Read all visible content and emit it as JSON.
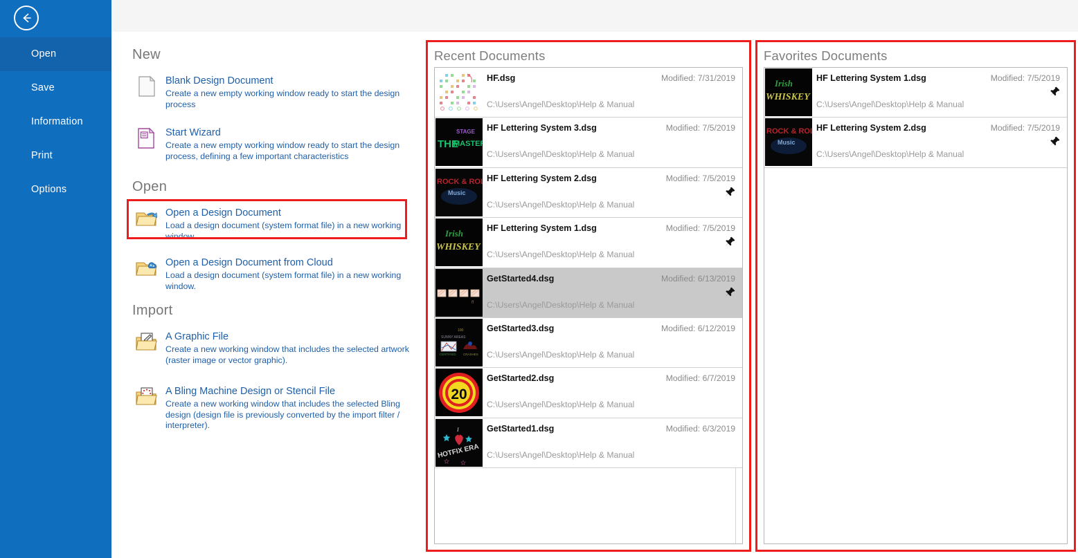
{
  "sidebar": {
    "back_icon": "back-arrow-icon",
    "items": [
      {
        "label": "Open",
        "active": true
      },
      {
        "label": "Save",
        "active": false
      },
      {
        "label": "Information",
        "active": false
      },
      {
        "label": "Print",
        "active": false
      },
      {
        "label": "Options",
        "active": false
      }
    ]
  },
  "sections": {
    "new": {
      "title": "New",
      "commands": [
        {
          "icon": "blank-document-icon",
          "title": "Blank Design Document",
          "description": "Create a new empty working window ready to start the design process"
        },
        {
          "icon": "wizard-document-icon",
          "title": "Start Wizard",
          "description": "Create a new empty working window ready to start the design process, defining a few important characteristics"
        }
      ]
    },
    "open": {
      "title": "Open",
      "commands": [
        {
          "icon": "open-folder-icon",
          "title": "Open a Design Document",
          "description": "Load a design document (system format file) in a new working window.",
          "highlighted": true
        },
        {
          "icon": "cloud-folder-icon",
          "title": "Open a Design Document from Cloud",
          "description": "Load a design document (system format file) in a new working window.",
          "highlighted": false
        }
      ]
    },
    "import": {
      "title": "Import",
      "commands": [
        {
          "icon": "graphic-file-folder-icon",
          "title": "A Graphic File",
          "description": "Create a new working window that includes the selected artwork (raster image or vector graphic)."
        },
        {
          "icon": "bling-file-folder-icon",
          "title": "A Bling Machine Design or Stencil File",
          "description": "Create a new working window that includes the selected Bling design (design file is previously converted by the import filter / interpreter)."
        }
      ]
    }
  },
  "recent_documents": {
    "title": "Recent Documents",
    "items": [
      {
        "name": "HF.dsg",
        "modified": "Modified: 7/31/2019",
        "path": "C:\\Users\\Angel\\Desktop\\Help & Manual",
        "pinned": false,
        "selected": false,
        "thumb": "hf-grid"
      },
      {
        "name": "HF Lettering System 3.dsg",
        "modified": "Modified: 7/5/2019",
        "path": "C:\\Users\\Angel\\Desktop\\Help & Manual",
        "pinned": false,
        "selected": false,
        "thumb": "the-stage-master"
      },
      {
        "name": "HF Lettering System 2.dsg",
        "modified": "Modified: 7/5/2019",
        "path": "C:\\Users\\Angel\\Desktop\\Help & Manual",
        "pinned": true,
        "selected": false,
        "thumb": "rock-n-roll"
      },
      {
        "name": "HF Lettering System 1.dsg",
        "modified": "Modified: 7/5/2019",
        "path": "C:\\Users\\Angel\\Desktop\\Help & Manual",
        "pinned": true,
        "selected": false,
        "thumb": "irish-whiskey"
      },
      {
        "name": "GetStarted4.dsg",
        "modified": "Modified: 6/13/2019",
        "path": "C:\\Users\\Angel\\Desktop\\Help & Manual",
        "pinned": true,
        "selected": true,
        "thumb": "four-squares"
      },
      {
        "name": "GetStarted3.dsg",
        "modified": "Modified: 6/12/2019",
        "path": "C:\\Users\\Angel\\Desktop\\Help & Manual",
        "pinned": false,
        "selected": false,
        "thumb": "scene"
      },
      {
        "name": "GetStarted2.dsg",
        "modified": "Modified: 6/7/2019",
        "path": "C:\\Users\\Angel\\Desktop\\Help & Manual",
        "pinned": false,
        "selected": false,
        "thumb": "sign-20"
      },
      {
        "name": "GetStarted1.dsg",
        "modified": "Modified: 6/3/2019",
        "path": "C:\\Users\\Angel\\Desktop\\Help & Manual",
        "pinned": false,
        "selected": false,
        "thumb": "hotfix-era"
      }
    ]
  },
  "favorites_documents": {
    "title": "Favorites Documents",
    "items": [
      {
        "name": "HF Lettering System 1.dsg",
        "modified": "Modified: 7/5/2019",
        "path": "C:\\Users\\Angel\\Desktop\\Help & Manual",
        "pinned": true,
        "selected": false,
        "thumb": "irish-whiskey"
      },
      {
        "name": "HF Lettering System 2.dsg",
        "modified": "Modified: 7/5/2019",
        "path": "C:\\Users\\Angel\\Desktop\\Help & Manual",
        "pinned": true,
        "selected": false,
        "thumb": "rock-n-roll"
      }
    ]
  },
  "colors": {
    "sidebar": "#106ebe",
    "sidebar_active": "#1263ab",
    "highlight_box": "#ee1c1c",
    "link": "#1f5fa9",
    "selected_row": "#c9c9c9"
  }
}
